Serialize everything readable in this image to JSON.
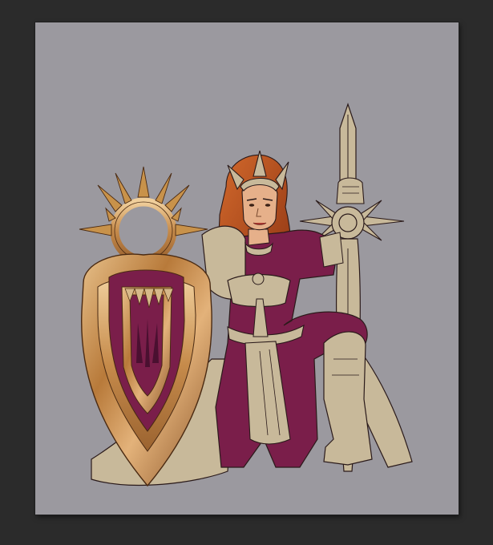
{
  "app": {
    "view": "image-editor-canvas"
  },
  "colors": {
    "workspace_background": "#2b2b2b",
    "canvas_background": "#9b999f",
    "armor_beige": "#c8b99a",
    "cloth_magenta": "#7a1e4a",
    "gold_bronze": "#c8924a",
    "hair_auburn": "#b4501e",
    "skin": "#e6b08a",
    "line": "#2a1a1a"
  },
  "canvas": {
    "content": "character-illustration",
    "subject_elements": [
      "sun-shield",
      "sword",
      "crown",
      "armored-figure"
    ]
  }
}
